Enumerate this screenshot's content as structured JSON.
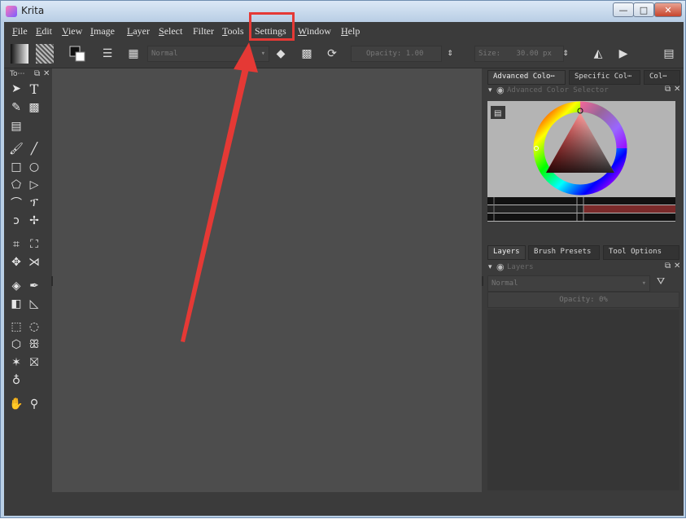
{
  "window": {
    "title": "Krita",
    "controls": {
      "minimize": "—",
      "maximize": "□",
      "close": "✕"
    }
  },
  "menubar": [
    {
      "label": "File",
      "key": "F",
      "rest": "ile"
    },
    {
      "label": "Edit",
      "key": "E",
      "rest": "dit"
    },
    {
      "label": "View",
      "key": "V",
      "rest": "iew"
    },
    {
      "label": "Image",
      "key": "I",
      "rest": "mage"
    },
    {
      "label": "Layer",
      "key": "L",
      "rest": "ayer"
    },
    {
      "label": "Select",
      "key": "S",
      "rest": "elect"
    },
    {
      "label": "Filter",
      "key": "",
      "rest": "Filter"
    },
    {
      "label": "Tools",
      "key": "T",
      "rest": "ools"
    },
    {
      "label": "Settings",
      "key": "",
      "rest": "Settings"
    },
    {
      "label": "Window",
      "key": "W",
      "rest": "indow"
    },
    {
      "label": "Help",
      "key": "H",
      "rest": "elp"
    }
  ],
  "toolbar": {
    "blend_mode": "Normal",
    "opacity_label": "Opacity:",
    "opacity_value": "1.00",
    "size_label": "Size:",
    "size_value": "30.00 px"
  },
  "toolbox": {
    "title": "To⋯"
  },
  "dock": {
    "tabs_top": [
      "Advanced Colo⋯",
      "Specific Col⋯",
      "Col⋯"
    ],
    "color_docker_title": "Advanced Color Selector",
    "tabs_bottom": [
      "Layers",
      "Brush Presets",
      "Tool Options"
    ],
    "layers_docker_title": "Layers",
    "layers_blend_mode": "Normal",
    "layers_opacity": "Opacity:  0%"
  },
  "colors": {
    "annotation": "#e53935",
    "canvas_bg": "#4d4d4d",
    "ui_bg": "#3b3b3b"
  }
}
